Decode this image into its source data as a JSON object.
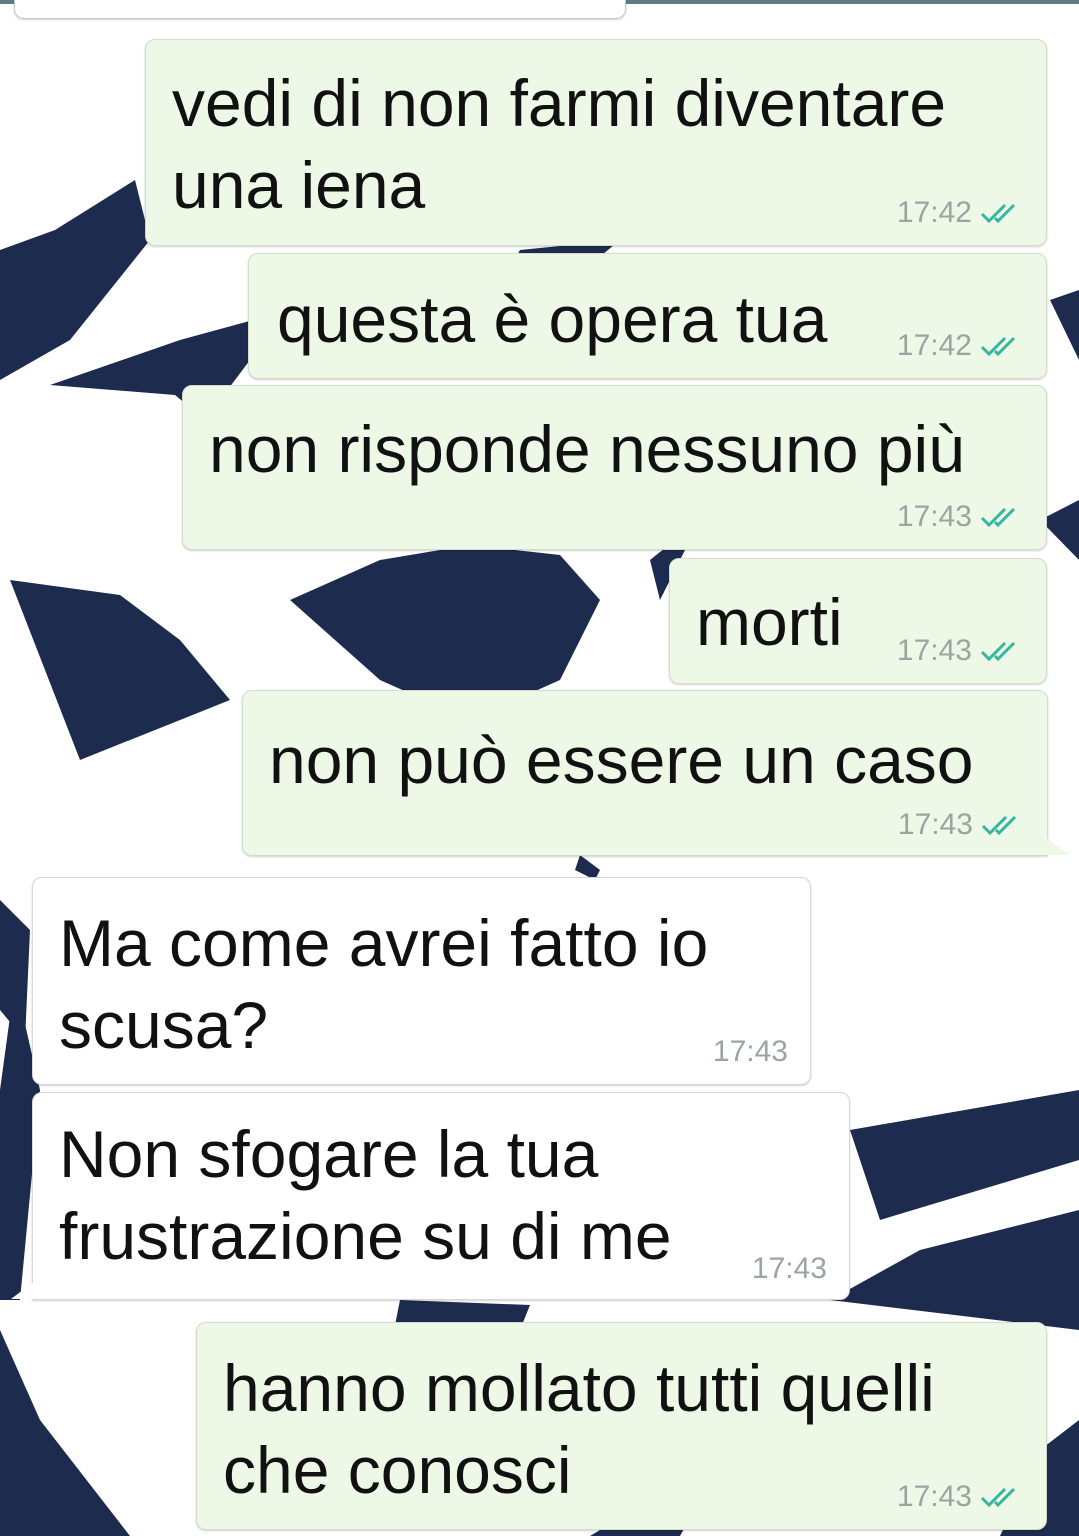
{
  "chat": {
    "messages": [
      {
        "direction": "out",
        "lines": [
          "vedi di non farmi diventare",
          "una iena"
        ],
        "time": "17:42",
        "status": "read"
      },
      {
        "direction": "out",
        "lines": [
          "questa è opera tua"
        ],
        "time": "17:42",
        "status": "read"
      },
      {
        "direction": "out",
        "lines": [
          "non risponde nessuno più"
        ],
        "time": "17:43",
        "status": "read"
      },
      {
        "direction": "out",
        "lines": [
          "morti"
        ],
        "time": "17:43",
        "status": "read"
      },
      {
        "direction": "out",
        "lines": [
          "non può essere un caso"
        ],
        "time": "17:43",
        "status": "read"
      },
      {
        "direction": "in",
        "lines": [
          "Ma come avrei fatto io",
          "scusa?"
        ],
        "time": "17:43"
      },
      {
        "direction": "in",
        "lines": [
          "Non sfogare la tua",
          "frustrazione su di me"
        ],
        "time": "17:43"
      },
      {
        "direction": "out",
        "lines": [
          "hanno mollato tutti quelli",
          "che conosci"
        ],
        "time": "17:43",
        "status": "read"
      }
    ]
  },
  "theme": {
    "outgoing_bubble": "#eef8e6",
    "incoming_bubble": "#ffffff",
    "read_ticks": "#34b7a0",
    "wallpaper_emblem": "#1d2b4f",
    "timestamp": "#9aa5a2"
  },
  "icons": {
    "read_receipt": "double-check-icon",
    "wallpaper": "star-ball-emblem"
  }
}
